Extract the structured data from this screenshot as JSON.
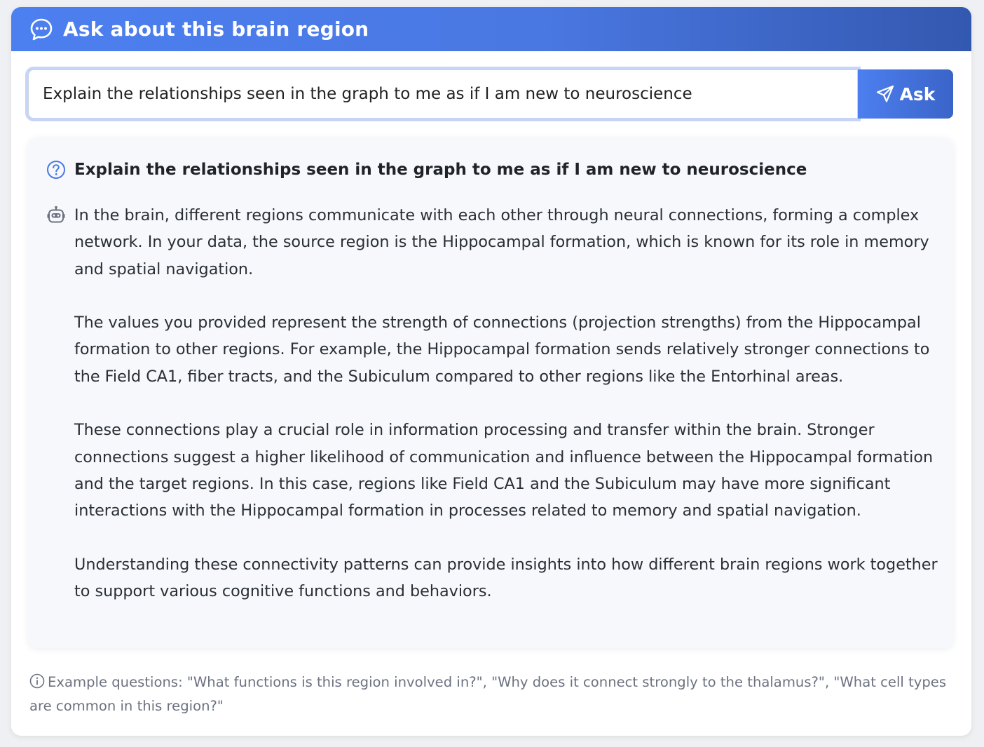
{
  "header": {
    "title": "Ask about this brain region",
    "icon": "chat-bubble-icon"
  },
  "ask": {
    "input_value": "Explain the relationships seen in the graph to me as if I am new to neuroscience",
    "button_label": "Ask",
    "button_icon": "send-icon"
  },
  "conversation": {
    "question_icon": "question-circle-icon",
    "question": "Explain the relationships seen in the graph to me as if I am new to neuroscience",
    "answer_icon": "robot-icon",
    "answer_paragraphs": [
      "In the brain, different regions communicate with each other through neural connections, forming a complex network. In your data, the source region is the Hippocampal formation, which is known for its role in memory and spatial navigation.",
      "The values you provided represent the strength of connections (projection strengths) from the Hippocampal formation to other regions. For example, the Hippocampal formation sends relatively stronger connections to the Field CA1, fiber tracts, and the Subiculum compared to other regions like the Entorhinal areas.",
      "These connections play a crucial role in information processing and transfer within the brain. Stronger connections suggest a higher likelihood of communication and influence between the Hippocampal formation and the target regions. In this case, regions like Field CA1 and the Subiculum may have more significant interactions with the Hippocampal formation in processes related to memory and spatial navigation.",
      "Understanding these connectivity patterns can provide insights into how different brain regions work together to support various cognitive functions and behaviors."
    ]
  },
  "hint": {
    "icon": "info-circle-icon",
    "text": "Example questions: \"What functions is this region involved in?\", \"Why does it connect strongly to the thalamus?\", \"What cell types are common in this region?\""
  },
  "colors": {
    "header_start": "#4c7ff0",
    "header_end": "#3358b0",
    "accent": "#4a78e2",
    "panel_bg": "#f6f8fb"
  }
}
